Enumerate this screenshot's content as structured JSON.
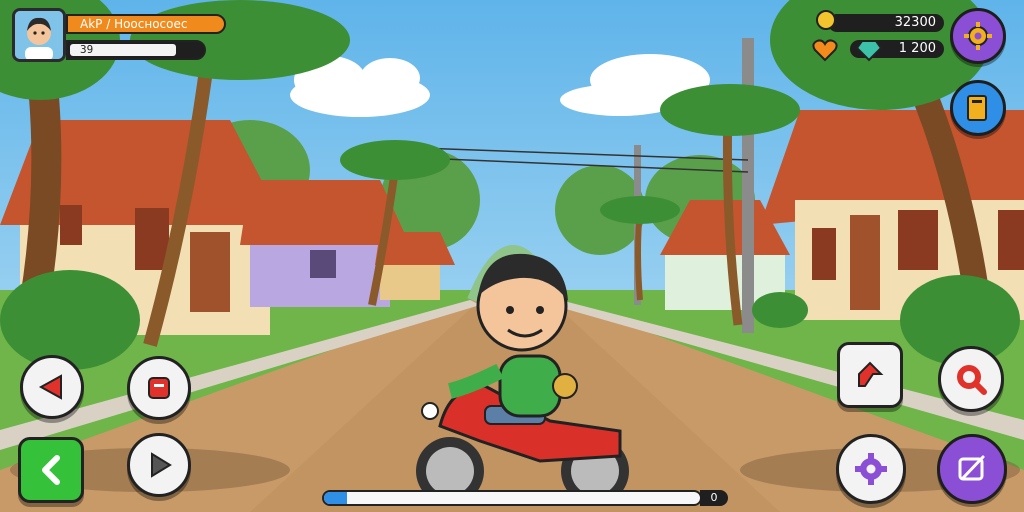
{
  "player": {
    "name": "AkР / Ноосносоес",
    "level": "39"
  },
  "resources": {
    "coins": "32300",
    "gems": "1 200"
  },
  "progress": {
    "fraction": 0.06,
    "end_label": "0"
  },
  "controls": {
    "left_cluster": [
      "left-arrow",
      "stop",
      "back",
      "play"
    ],
    "right_cluster": [
      "up-arrow",
      "search",
      "settings",
      "edit"
    ]
  },
  "colors": {
    "accent_orange": "#f08a1c",
    "accent_purple": "#8b4fd6",
    "accent_blue": "#2f8fe6",
    "accent_green": "#35c23a",
    "accent_red": "#e0322a"
  },
  "icons": {
    "top_right_gear": "gear-icon",
    "top_right_book": "book-icon",
    "coin": "coin-icon",
    "heart": "heart-icon",
    "gem": "gem-icon"
  }
}
